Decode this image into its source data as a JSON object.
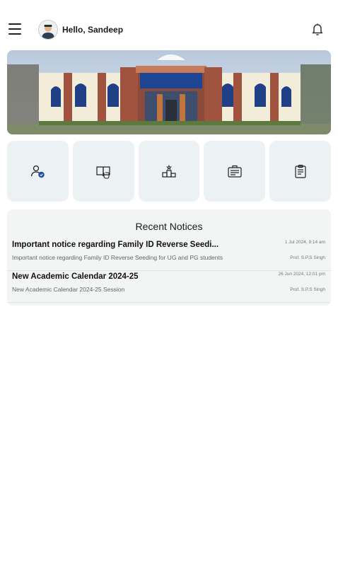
{
  "header": {
    "greeting": "Hello, Sandeep"
  },
  "quick_actions": [
    {
      "icon": "user-check-icon"
    },
    {
      "icon": "book-hand-icon"
    },
    {
      "icon": "podium-icon"
    },
    {
      "icon": "id-card-icon"
    },
    {
      "icon": "clipboard-icon"
    }
  ],
  "notices": {
    "title": "Recent Notices",
    "items": [
      {
        "title": "Important notice regarding Family ID Reverse Seedi...",
        "description": "Important notice regarding Family ID Reverse Seeding for UG and PG students",
        "date": "1 Jul 2024, 9:14 am",
        "author": "Prof. S.P.S Singh"
      },
      {
        "title": "New Academic Calendar 2024-25",
        "description": "New Academic Calendar 2024-25 Session",
        "date": "26 Jun 2024, 12:01 pm",
        "author": "Prof. S.P.S Singh"
      }
    ]
  },
  "colors": {
    "tile_bg": "#ecf1f3",
    "panel_bg": "#f3f4f4",
    "brick": "#a0533f",
    "window_blue": "#1f3f86"
  }
}
